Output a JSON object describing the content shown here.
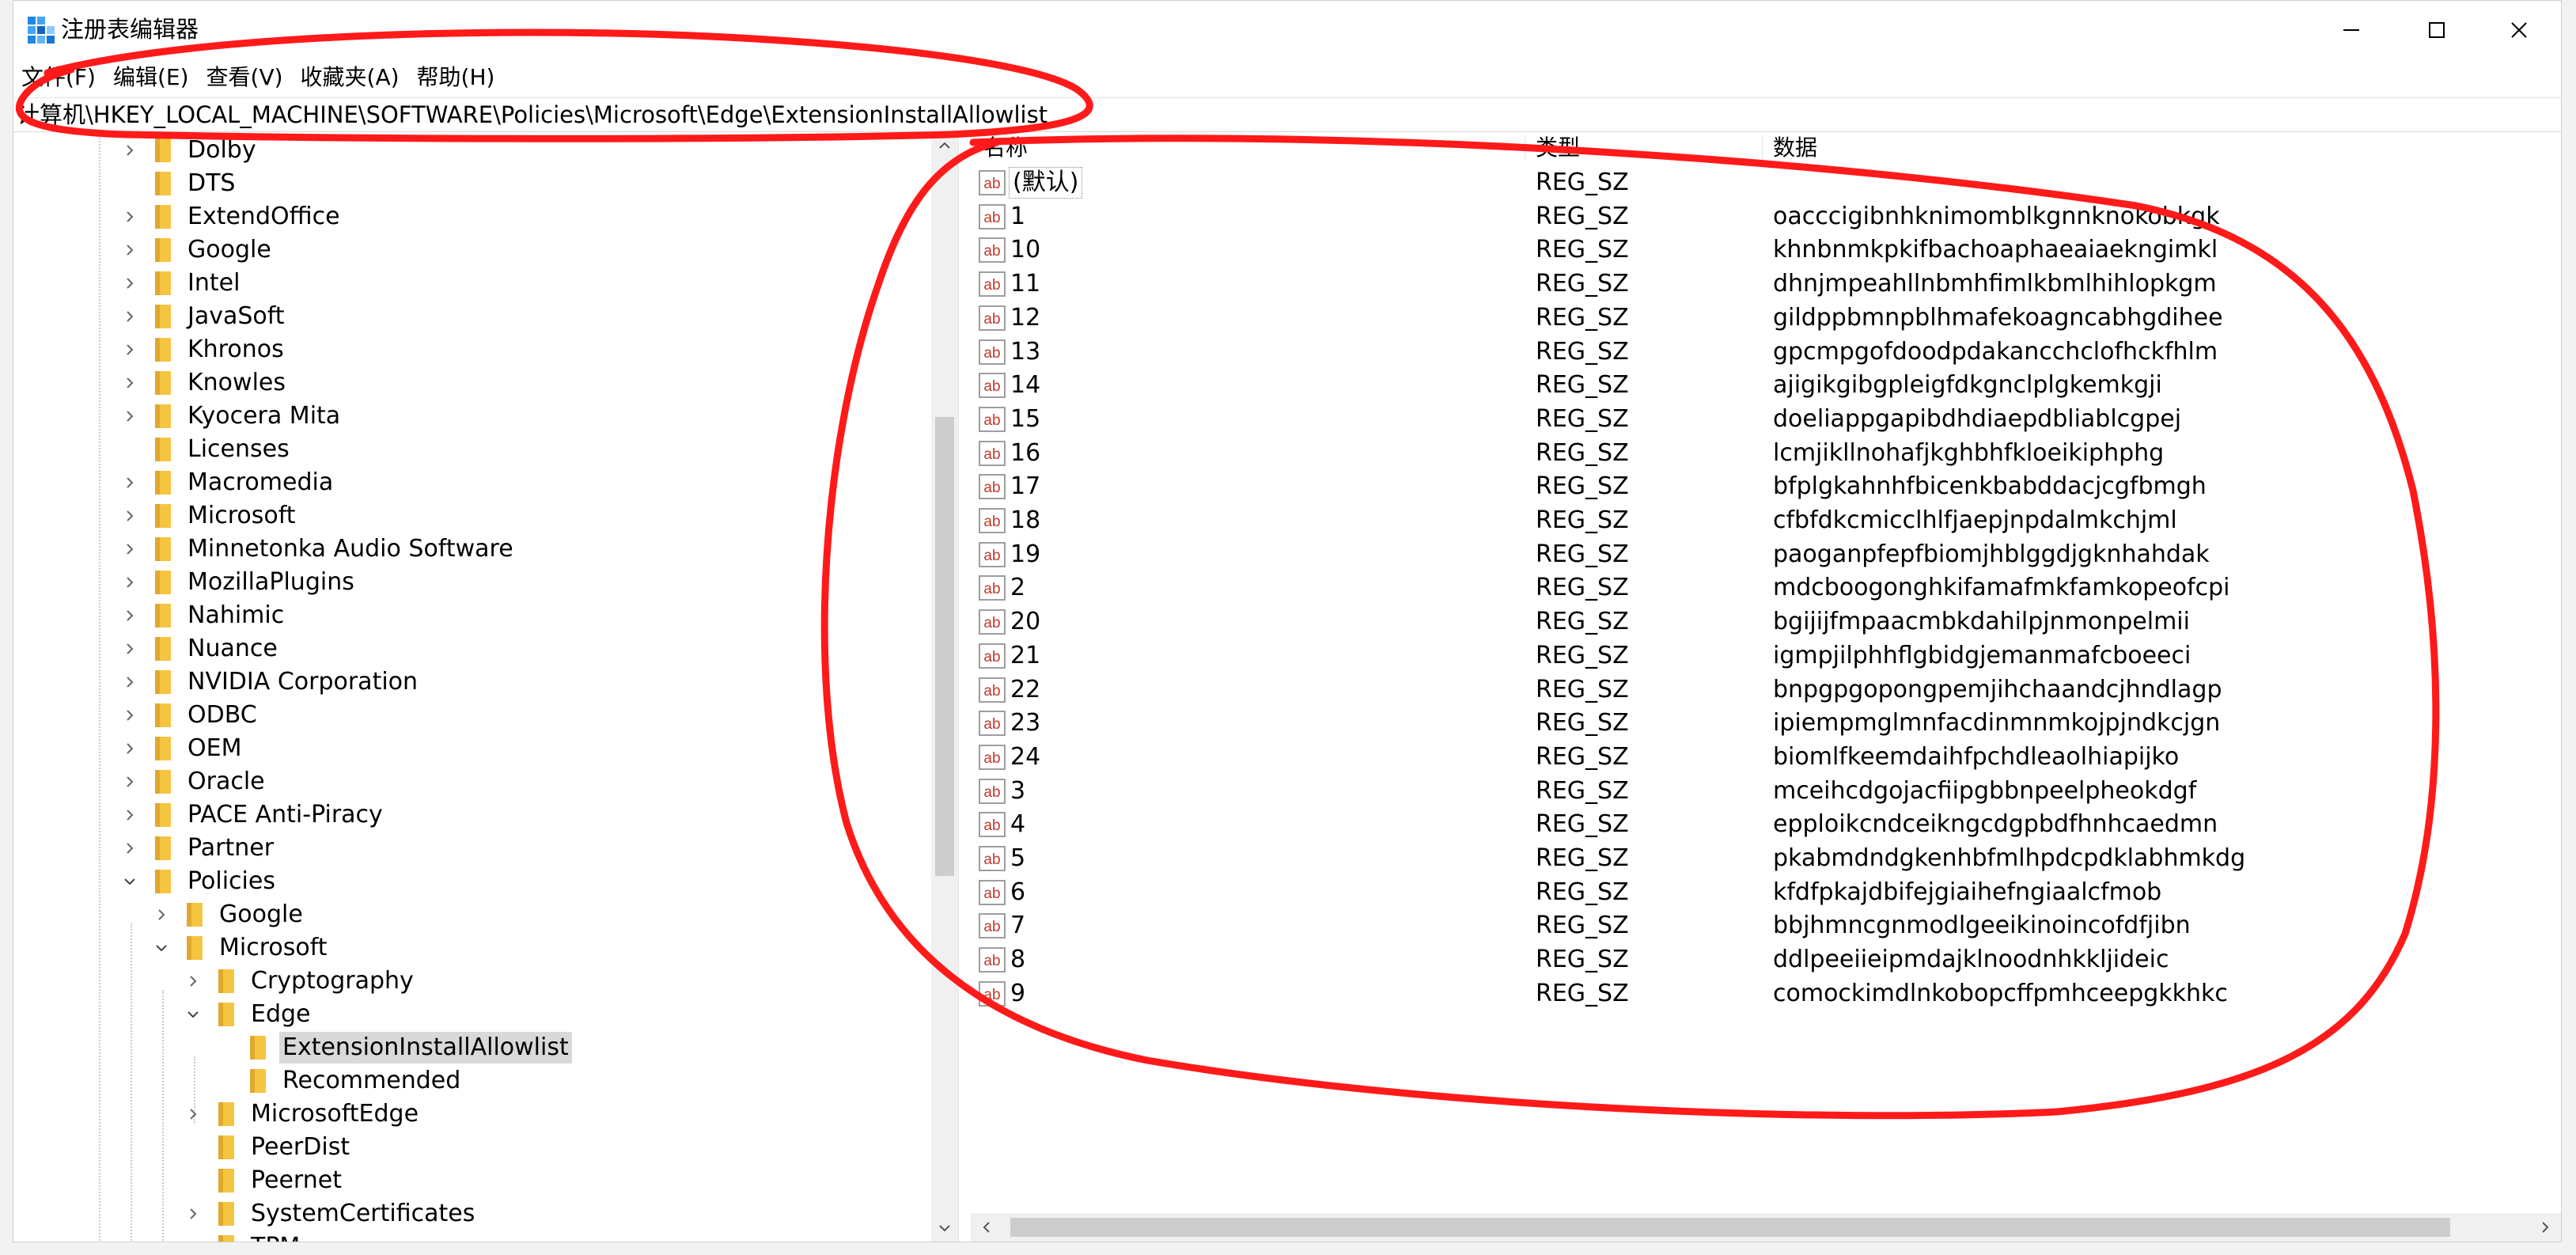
{
  "window": {
    "title": "注册表编辑器",
    "controls": {
      "minimize": "minimize",
      "maximize": "maximize",
      "close": "close"
    }
  },
  "menu": [
    "文件(F)",
    "编辑(E)",
    "查看(V)",
    "收藏夹(A)",
    "帮助(H)"
  ],
  "address": "计算机\\HKEY_LOCAL_MACHINE\\SOFTWARE\\Policies\\Microsoft\\Edge\\ExtensionInstallAllowlist",
  "tree": [
    {
      "label": "Dolby",
      "level": 0,
      "state": "collapsed"
    },
    {
      "label": "DTS",
      "level": 0,
      "state": "none"
    },
    {
      "label": "ExtendOffice",
      "level": 0,
      "state": "collapsed"
    },
    {
      "label": "Google",
      "level": 0,
      "state": "collapsed"
    },
    {
      "label": "Intel",
      "level": 0,
      "state": "collapsed"
    },
    {
      "label": "JavaSoft",
      "level": 0,
      "state": "collapsed"
    },
    {
      "label": "Khronos",
      "level": 0,
      "state": "collapsed"
    },
    {
      "label": "Knowles",
      "level": 0,
      "state": "collapsed"
    },
    {
      "label": "Kyocera Mita",
      "level": 0,
      "state": "collapsed"
    },
    {
      "label": "Licenses",
      "level": 0,
      "state": "none"
    },
    {
      "label": "Macromedia",
      "level": 0,
      "state": "collapsed"
    },
    {
      "label": "Microsoft",
      "level": 0,
      "state": "collapsed"
    },
    {
      "label": "Minnetonka Audio Software",
      "level": 0,
      "state": "collapsed"
    },
    {
      "label": "MozillaPlugins",
      "level": 0,
      "state": "collapsed"
    },
    {
      "label": "Nahimic",
      "level": 0,
      "state": "collapsed"
    },
    {
      "label": "Nuance",
      "level": 0,
      "state": "collapsed"
    },
    {
      "label": "NVIDIA Corporation",
      "level": 0,
      "state": "collapsed"
    },
    {
      "label": "ODBC",
      "level": 0,
      "state": "collapsed"
    },
    {
      "label": "OEM",
      "level": 0,
      "state": "collapsed"
    },
    {
      "label": "Oracle",
      "level": 0,
      "state": "collapsed"
    },
    {
      "label": "PACE Anti-Piracy",
      "level": 0,
      "state": "collapsed"
    },
    {
      "label": "Partner",
      "level": 0,
      "state": "collapsed"
    },
    {
      "label": "Policies",
      "level": 0,
      "state": "expanded"
    },
    {
      "label": "Google",
      "level": 1,
      "state": "collapsed"
    },
    {
      "label": "Microsoft",
      "level": 1,
      "state": "expanded"
    },
    {
      "label": "Cryptography",
      "level": 2,
      "state": "collapsed"
    },
    {
      "label": "Edge",
      "level": 2,
      "state": "expanded"
    },
    {
      "label": "ExtensionInstallAllowlist",
      "level": 3,
      "state": "none",
      "selected": true
    },
    {
      "label": "Recommended",
      "level": 3,
      "state": "none"
    },
    {
      "label": "MicrosoftEdge",
      "level": 2,
      "state": "collapsed"
    },
    {
      "label": "PeerDist",
      "level": 2,
      "state": "none"
    },
    {
      "label": "Peernet",
      "level": 2,
      "state": "none"
    },
    {
      "label": "SystemCertificates",
      "level": 2,
      "state": "collapsed"
    },
    {
      "label": "TPM",
      "level": 2,
      "state": "none"
    }
  ],
  "columns": {
    "name": "名称",
    "type": "类型",
    "data": "数据"
  },
  "values": [
    {
      "name": "(默认)",
      "type": "REG_SZ",
      "data": ""
    },
    {
      "name": "1",
      "type": "REG_SZ",
      "data": "oacccigibnhknimomblkgnnknokobkgk"
    },
    {
      "name": "10",
      "type": "REG_SZ",
      "data": "khnbnmkpkifbachoaphaeaiaekngimkl"
    },
    {
      "name": "11",
      "type": "REG_SZ",
      "data": "dhnjmpeahllnbmhfimlkbmlhihlopkgm"
    },
    {
      "name": "12",
      "type": "REG_SZ",
      "data": "gildppbmnpblhmafekoagncabhgdihee"
    },
    {
      "name": "13",
      "type": "REG_SZ",
      "data": "gpcmpgofdoodpdakancchclofhckfhlm"
    },
    {
      "name": "14",
      "type": "REG_SZ",
      "data": "ajigikgibgpleigfdkgnclplgkemkgji"
    },
    {
      "name": "15",
      "type": "REG_SZ",
      "data": "doeliappgapibdhdiaepdbliablcgpej"
    },
    {
      "name": "16",
      "type": "REG_SZ",
      "data": "lcmjikllnohafjkghbhfkloeikiphphg"
    },
    {
      "name": "17",
      "type": "REG_SZ",
      "data": "bfplgkahnhfbicenkbabddacjcgfbmgh"
    },
    {
      "name": "18",
      "type": "REG_SZ",
      "data": "cfbfdkcmicclhlfjaepjnpdalmkchjml"
    },
    {
      "name": "19",
      "type": "REG_SZ",
      "data": "paoganpfepfbiomjhblggdjgknhahdak"
    },
    {
      "name": "2",
      "type": "REG_SZ",
      "data": "mdcboogonghkifamafmkfamkopeofcpi"
    },
    {
      "name": "20",
      "type": "REG_SZ",
      "data": "bgijijfmpaacmbkdahilpjnmonpelmii"
    },
    {
      "name": "21",
      "type": "REG_SZ",
      "data": "igmpjilphhflgbidgjemanmafcboeeci"
    },
    {
      "name": "22",
      "type": "REG_SZ",
      "data": "bnpgpgopongpemjihchaandcjhndlagp"
    },
    {
      "name": "23",
      "type": "REG_SZ",
      "data": "ipiempmglmnfacdinmnmkojpjndkcjgn"
    },
    {
      "name": "24",
      "type": "REG_SZ",
      "data": "biomlfkeemdaihfpchdleaolhiapijko"
    },
    {
      "name": "3",
      "type": "REG_SZ",
      "data": "mceihcdgojacfiipgbbnpeelpheokdgf"
    },
    {
      "name": "4",
      "type": "REG_SZ",
      "data": "epploikcndceikngcdgpbdfhnhcaedmn"
    },
    {
      "name": "5",
      "type": "REG_SZ",
      "data": "pkabmdndgkenhbfmlhpdcpdklabhmkdg"
    },
    {
      "name": "6",
      "type": "REG_SZ",
      "data": "kfdfpkajdbifejgiaihefngiaalcfmob"
    },
    {
      "name": "7",
      "type": "REG_SZ",
      "data": "bbjhmncgnmodlgeeikinoincofdfjibn"
    },
    {
      "name": "8",
      "type": "REG_SZ",
      "data": "ddlpeeiieipmdajklnoodnhkkljideic"
    },
    {
      "name": "9",
      "type": "REG_SZ",
      "data": "comockimdlnkobopcffpmhceepgkkhkc"
    }
  ],
  "colors": {
    "annotation": "#ff1a1a",
    "folder": "#f5c542",
    "selection": "#d9d9d9",
    "reg_icon": "#c0392b"
  },
  "icons": {
    "app": "registry-editor-icon",
    "folder": "folder-icon",
    "value": "reg-sz-value-icon"
  }
}
